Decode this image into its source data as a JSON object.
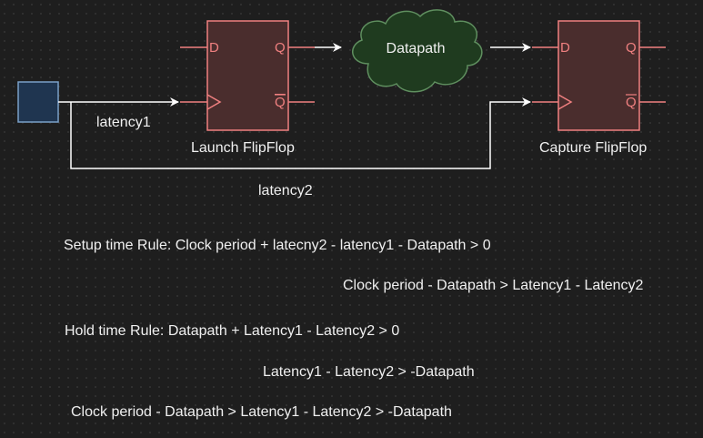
{
  "diagram": {
    "launch_ff": {
      "label": "Launch FlipFlop",
      "pin_d": "D",
      "pin_q": "Q",
      "pin_qbar": "Q"
    },
    "capture_ff": {
      "label": "Capture FlipFlop",
      "pin_d": "D",
      "pin_q": "Q",
      "pin_qbar": "Q"
    },
    "datapath": {
      "label": "Datapath"
    },
    "wires": {
      "latency1": "latency1",
      "latency2": "latency2"
    },
    "colors": {
      "background": "#1e1e1e",
      "ff_fill": "#4a2d2d",
      "ff_stroke": "#f08080",
      "cloud_fill": "#1f3b1f",
      "cloud_stroke": "#5f8f5f",
      "clock_fill": "#1f3550",
      "clock_stroke": "#7aa0c8",
      "wire": "#ffffff",
      "text": "#f0f0f0"
    }
  },
  "equations": {
    "setup_rule": "Setup time Rule: Clock period + latecny2 - latency1 - Datapath > 0",
    "setup_derived": "Clock period - Datapath >  Latency1 - Latency2",
    "hold_rule": "Hold time Rule: Datapath + Latency1 - Latency2 > 0",
    "hold_derived": "Latency1 - Latency2 > -Datapath",
    "combined": "Clock period - Datapath >  Latency1 - Latency2 > -Datapath"
  }
}
